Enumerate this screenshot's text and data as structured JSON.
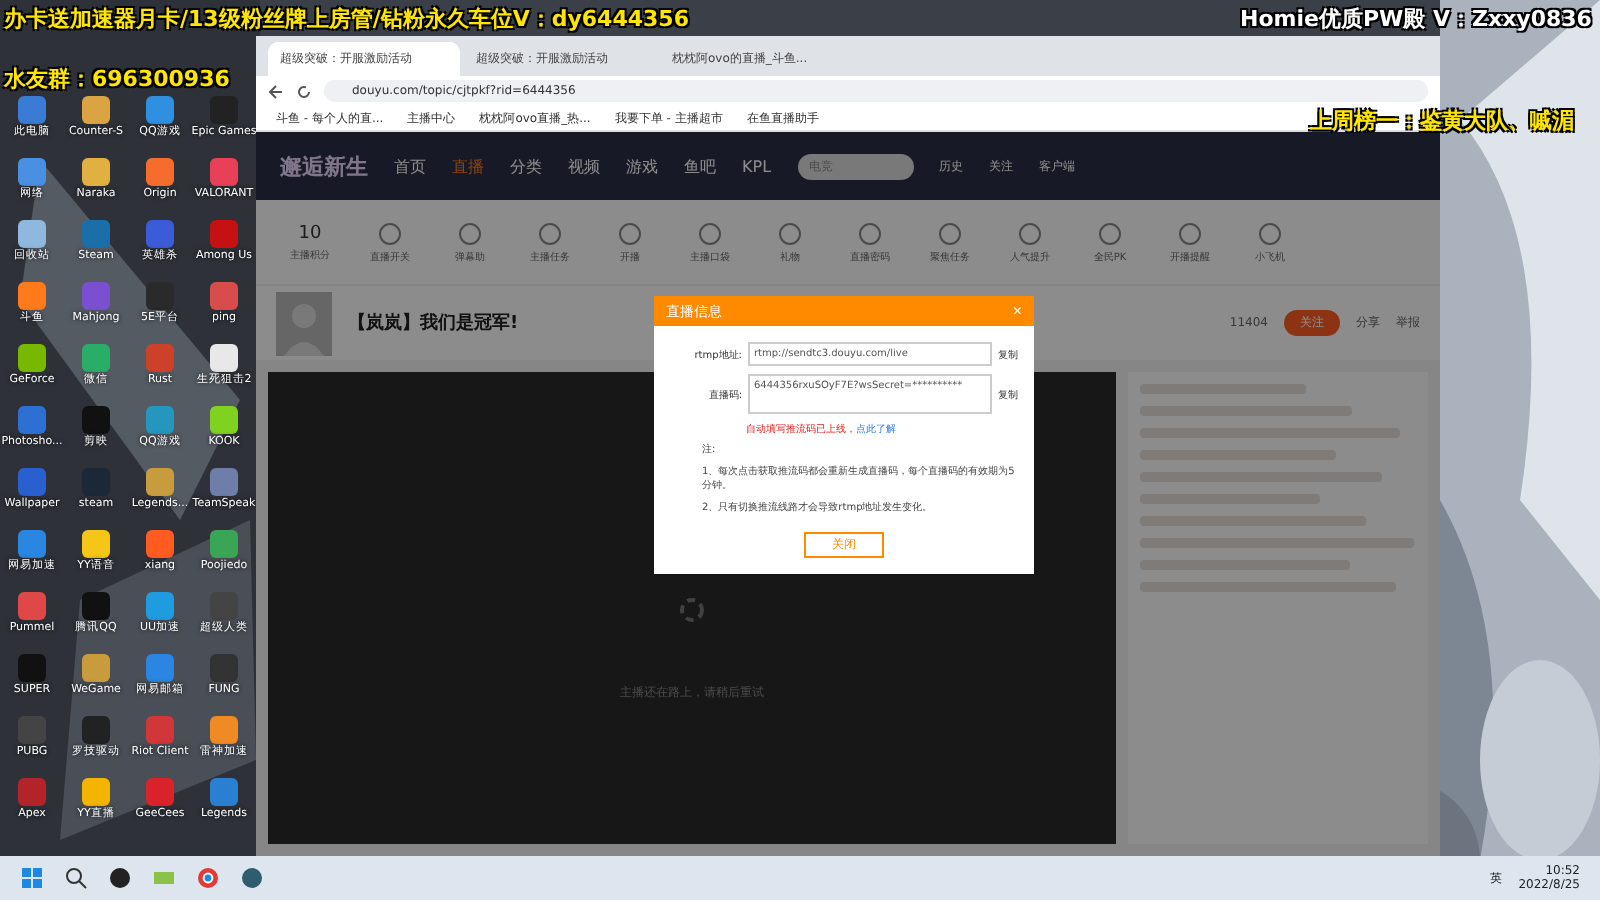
{
  "stream_overlay": {
    "promo": "办卡送加速器月卡/13级粉丝牌上房管/钻粉永久车位V：dy6444356",
    "fan_group": "水友群：696300936",
    "pw_ad": "Homie优质PW殿 V：Zxxy0836",
    "top_fan": "上周榜一：鉴黄大队、嘁湄"
  },
  "desktop_icons": [
    {
      "label": "此电脑",
      "color": "#3a7bd5"
    },
    {
      "label": "Counter-S",
      "color": "#d9a441"
    },
    {
      "label": "QQ游戏",
      "color": "#2f8fe0"
    },
    {
      "label": "Epic Games",
      "color": "#222222"
    },
    {
      "label": "网络",
      "color": "#4a90e2"
    },
    {
      "label": "Naraka",
      "color": "#e0b040"
    },
    {
      "label": "Origin",
      "color": "#f56c2d"
    },
    {
      "label": "VALORANT",
      "color": "#e84057"
    },
    {
      "label": "回收站",
      "color": "#8fb8de"
    },
    {
      "label": "Steam",
      "color": "#1b6fa8"
    },
    {
      "label": "英雄杀",
      "color": "#3b5bd9"
    },
    {
      "label": "Among Us",
      "color": "#c51111"
    },
    {
      "label": "斗鱼",
      "color": "#ff7a1a"
    },
    {
      "label": "Mahjong",
      "color": "#7a4fd0"
    },
    {
      "label": "5E平台",
      "color": "#2a2a2a"
    },
    {
      "label": "ping",
      "color": "#d94c4c"
    },
    {
      "label": "GeForce",
      "color": "#76b900"
    },
    {
      "label": "微信",
      "color": "#2aae67"
    },
    {
      "label": "Rust",
      "color": "#cd412b"
    },
    {
      "label": "生死狙击2",
      "color": "#e8e8e8"
    },
    {
      "label": "Photosho...",
      "color": "#2d6fd2"
    },
    {
      "label": "剪映",
      "color": "#111111"
    },
    {
      "label": "QQ游戏",
      "color": "#2596be"
    },
    {
      "label": "KOOK",
      "color": "#7fd320"
    },
    {
      "label": "Wallpaper",
      "color": "#2a5fd0"
    },
    {
      "label": "steam",
      "color": "#1b2838"
    },
    {
      "label": "Legends...",
      "color": "#c89b3c"
    },
    {
      "label": "TeamSpeak",
      "color": "#6f7ea8"
    },
    {
      "label": "网易加速",
      "color": "#2a86e0"
    },
    {
      "label": "YY语音",
      "color": "#f5c518"
    },
    {
      "label": "xiang",
      "color": "#ff5a1f"
    },
    {
      "label": "Poojiedo",
      "color": "#3aa655"
    },
    {
      "label": "Pummel",
      "color": "#e04848"
    },
    {
      "label": "腾讯QQ",
      "color": "#111111"
    },
    {
      "label": "UU加速",
      "color": "#1f9be0"
    },
    {
      "label": "超级人类",
      "color": "#444444"
    },
    {
      "label": "SUPER",
      "color": "#111111"
    },
    {
      "label": "WeGame",
      "color": "#c89b3c"
    },
    {
      "label": "网易邮箱",
      "color": "#2a86e0"
    },
    {
      "label": "FUNG",
      "color": "#333333"
    },
    {
      "label": "PUBG",
      "color": "#444444"
    },
    {
      "label": "罗技驱动",
      "color": "#222222"
    },
    {
      "label": "Riot Client",
      "color": "#d13639"
    },
    {
      "label": "雷神加速",
      "color": "#f08a24"
    },
    {
      "label": "Apex",
      "color": "#b3242a"
    },
    {
      "label": "YY直播",
      "color": "#f5b400"
    },
    {
      "label": "GeeCees",
      "color": "#d8232a"
    },
    {
      "label": "Legends",
      "color": "#2a7fd0"
    }
  ],
  "browser": {
    "tabs": [
      {
        "title": "超级突破：开服激励活动",
        "selected": true
      },
      {
        "title": "超级突破：开服激励活动",
        "selected": false
      },
      {
        "title": "枕枕阿ovo的直播_斗鱼...",
        "selected": false
      }
    ],
    "url": "douyu.com/topic/cjtpkf?rid=6444356",
    "bookmarks": [
      "斗鱼 - 每个人的直...",
      "主播中心",
      "枕枕阿ovo直播_热...",
      "我要下单 - 主播超市",
      "在鱼直播助手"
    ],
    "banner": "邂逅新生",
    "nav": [
      {
        "label": "首页",
        "selected": false
      },
      {
        "label": "直播",
        "selected": true
      },
      {
        "label": "分类",
        "selected": false
      },
      {
        "label": "视频",
        "selected": false
      },
      {
        "label": "游戏",
        "selected": false
      },
      {
        "label": "鱼吧",
        "selected": false
      },
      {
        "label": "KPL",
        "selected": false
      }
    ],
    "search_placeholder": "电竞",
    "header_links": [
      "历史",
      "关注",
      "客户端"
    ],
    "points": {
      "value": "10",
      "label": "主播积分"
    },
    "tools": [
      "直播开关",
      "弹幕助",
      "主播任务",
      "开播",
      "主播口袋",
      "礼物",
      "直播密码",
      "聚焦任务",
      "人气提升",
      "全民PK",
      "开播提醒",
      "小飞机"
    ],
    "room": {
      "title": "【岚岚】我们是冠军!",
      "followers": "11404",
      "follow": "关注",
      "share": "分享",
      "report": "举报"
    },
    "player_message": "主播还在路上，请稍后重试",
    "dialog": {
      "title": "直播信息",
      "close": "×",
      "rows": [
        {
          "label": "rtmp地址:",
          "value": "rtmp://sendtc3.douyu.com/live",
          "copy": "复制"
        },
        {
          "label": "直播码:",
          "value": "6444356rxuSOyF7E?wsSecret=**********",
          "copy": "复制"
        }
      ],
      "warning": "自动填写推流码已上线，",
      "warning_link": "点此了解",
      "notes": [
        "注:",
        "1、每次点击获取推流码都会重新生成直播码，每个直播码的有效期为5分钟。",
        "2、只有切换推流线路才会导致rtmp地址发生变化。"
      ],
      "button": "关闭"
    }
  },
  "taskbar": {
    "ime": "英",
    "time": "10:52",
    "date": "2022/8/25"
  }
}
